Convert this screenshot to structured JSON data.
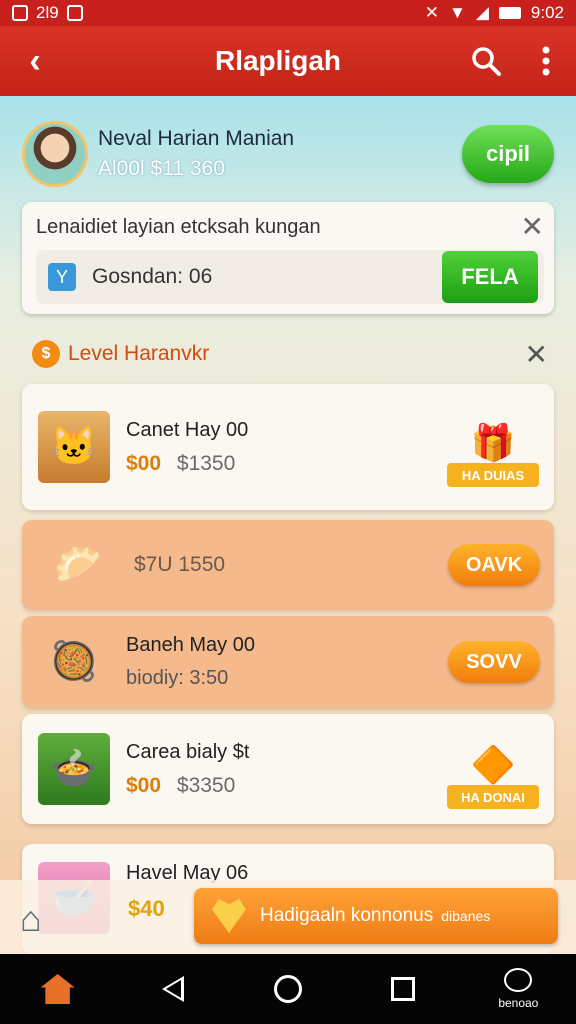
{
  "status_bar": {
    "time_left": "2l9",
    "time_right": "9:02"
  },
  "app_bar": {
    "back_icon": "chevron-left-icon",
    "title": "Rlapligah",
    "search_icon": "search-icon",
    "menu_icon": "more-vert-icon"
  },
  "user": {
    "name": "Neval Harian Manian",
    "balance": "Al00l $11 360",
    "button_label": "cipil"
  },
  "notice": {
    "text": "Lenaidiet layian etcksah kungan",
    "label": "Gosndan: 06",
    "button_label": "FELA"
  },
  "section": {
    "icon_text": "$",
    "title": "Level Haranvkr"
  },
  "items": [
    {
      "title": "Canet Hay 00",
      "price_main": "$00",
      "price_sub": "$1350",
      "action_label": "HA DUIAS"
    },
    {
      "price_sub": "$7U 1550",
      "action_label": "OAVK"
    },
    {
      "title": "Baneh May 00",
      "subtitle": "biodiy: 3:50",
      "action_label": "SOVV"
    },
    {
      "title": "Carea bialy $t",
      "price_main": "$00",
      "price_sub": "$3350",
      "action_label": "HA DONAI"
    },
    {
      "title": "Havel May 06",
      "price_main": "$40"
    }
  ],
  "bottom_banner": {
    "label": "Hadigaaln konnonus",
    "tag": "dibanes"
  },
  "nav": {
    "app_label": "benoao"
  },
  "colors": {
    "brand_red": "#c8201c",
    "accent_orange": "#f07e0c",
    "accent_green": "#27a816"
  }
}
